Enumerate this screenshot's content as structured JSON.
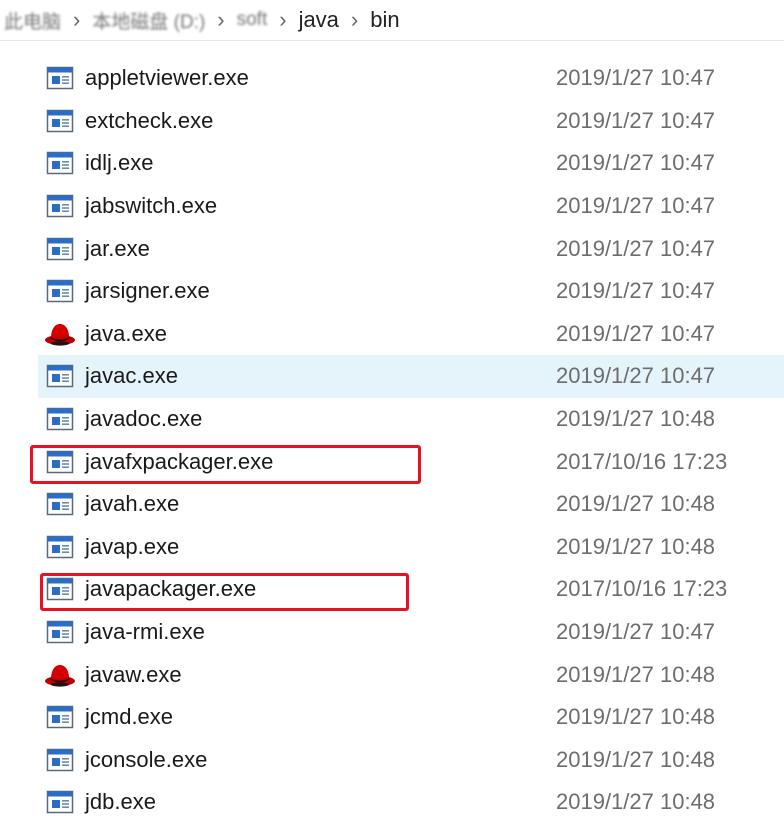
{
  "breadcrumb": {
    "items": [
      {
        "label": "此电脑",
        "blurred": true
      },
      {
        "label": "本地磁盘 (D:)",
        "blurred": true
      },
      {
        "label": "soft",
        "blurred": true
      },
      {
        "label": "java",
        "blurred": false
      },
      {
        "label": "bin",
        "blurred": false
      }
    ]
  },
  "files": [
    {
      "name": "appletviewer.exe",
      "date": "2019/1/27 10:47",
      "icon": "exe-window-icon"
    },
    {
      "name": "extcheck.exe",
      "date": "2019/1/27 10:47",
      "icon": "exe-window-icon"
    },
    {
      "name": "idlj.exe",
      "date": "2019/1/27 10:47",
      "icon": "exe-window-icon"
    },
    {
      "name": "jabswitch.exe",
      "date": "2019/1/27 10:47",
      "icon": "exe-window-icon"
    },
    {
      "name": "jar.exe",
      "date": "2019/1/27 10:47",
      "icon": "exe-window-icon"
    },
    {
      "name": "jarsigner.exe",
      "date": "2019/1/27 10:47",
      "icon": "exe-window-icon"
    },
    {
      "name": "java.exe",
      "date": "2019/1/27 10:47",
      "icon": "redhat-icon"
    },
    {
      "name": "javac.exe",
      "date": "2019/1/27 10:47",
      "icon": "exe-window-icon",
      "hovered": true
    },
    {
      "name": "javadoc.exe",
      "date": "2019/1/27 10:48",
      "icon": "exe-window-icon"
    },
    {
      "name": "javafxpackager.exe",
      "date": "2017/10/16 17:23",
      "icon": "exe-window-icon",
      "boxed": true
    },
    {
      "name": "javah.exe",
      "date": "2019/1/27 10:48",
      "icon": "exe-window-icon"
    },
    {
      "name": "javap.exe",
      "date": "2019/1/27 10:48",
      "icon": "exe-window-icon"
    },
    {
      "name": "javapackager.exe",
      "date": "2017/10/16 17:23",
      "icon": "exe-window-icon",
      "boxed": true
    },
    {
      "name": "java-rmi.exe",
      "date": "2019/1/27 10:47",
      "icon": "exe-window-icon"
    },
    {
      "name": "javaw.exe",
      "date": "2019/1/27 10:48",
      "icon": "redhat-icon"
    },
    {
      "name": "jcmd.exe",
      "date": "2019/1/27 10:48",
      "icon": "exe-window-icon"
    },
    {
      "name": "jconsole.exe",
      "date": "2019/1/27 10:48",
      "icon": "exe-window-icon"
    },
    {
      "name": "jdb.exe",
      "date": "2019/1/27 10:48",
      "icon": "exe-window-icon"
    }
  ],
  "colors": {
    "hover_bg": "#e5f3fb",
    "annotation_box": "#e81123",
    "date_text": "#6d6d6d"
  }
}
